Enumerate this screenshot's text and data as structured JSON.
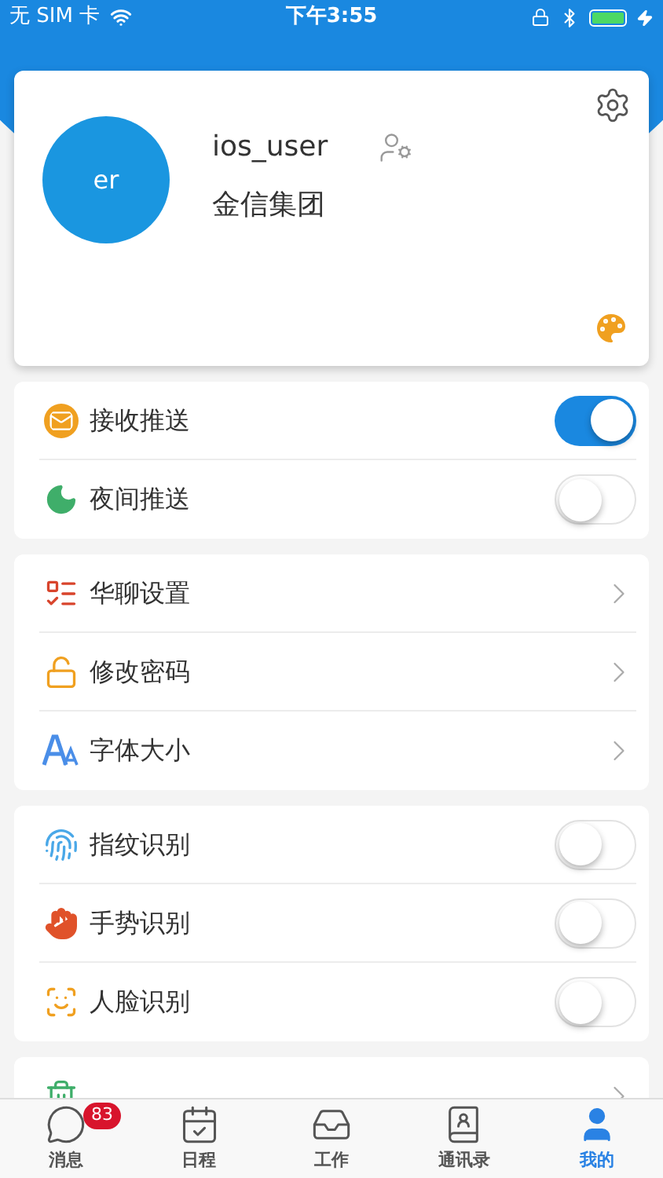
{
  "status_bar": {
    "carrier": "无 SIM 卡",
    "time": "下午3:55"
  },
  "profile": {
    "avatar_text": "er",
    "username": "ios_user",
    "company": "金信集团"
  },
  "sections": [
    {
      "rows": [
        {
          "label": "接收推送",
          "kind": "toggle",
          "on": true
        },
        {
          "label": "夜间推送",
          "kind": "toggle",
          "on": false
        }
      ]
    },
    {
      "rows": [
        {
          "label": "华聊设置",
          "kind": "link"
        },
        {
          "label": "修改密码",
          "kind": "link"
        },
        {
          "label": "字体大小",
          "kind": "link"
        }
      ]
    },
    {
      "rows": [
        {
          "label": "指纹识别",
          "kind": "toggle",
          "on": false
        },
        {
          "label": "手势识别",
          "kind": "toggle",
          "on": false
        },
        {
          "label": "人脸识别",
          "kind": "toggle",
          "on": false
        }
      ]
    },
    {
      "rows": [
        {
          "kind": "link"
        }
      ]
    }
  ],
  "tab_bar": [
    {
      "label": "消息",
      "selected": false,
      "badge": "83"
    },
    {
      "label": "日程",
      "selected": false
    },
    {
      "label": "工作",
      "selected": false
    },
    {
      "label": "通讯录",
      "selected": false
    },
    {
      "label": "我的",
      "selected": true
    }
  ]
}
